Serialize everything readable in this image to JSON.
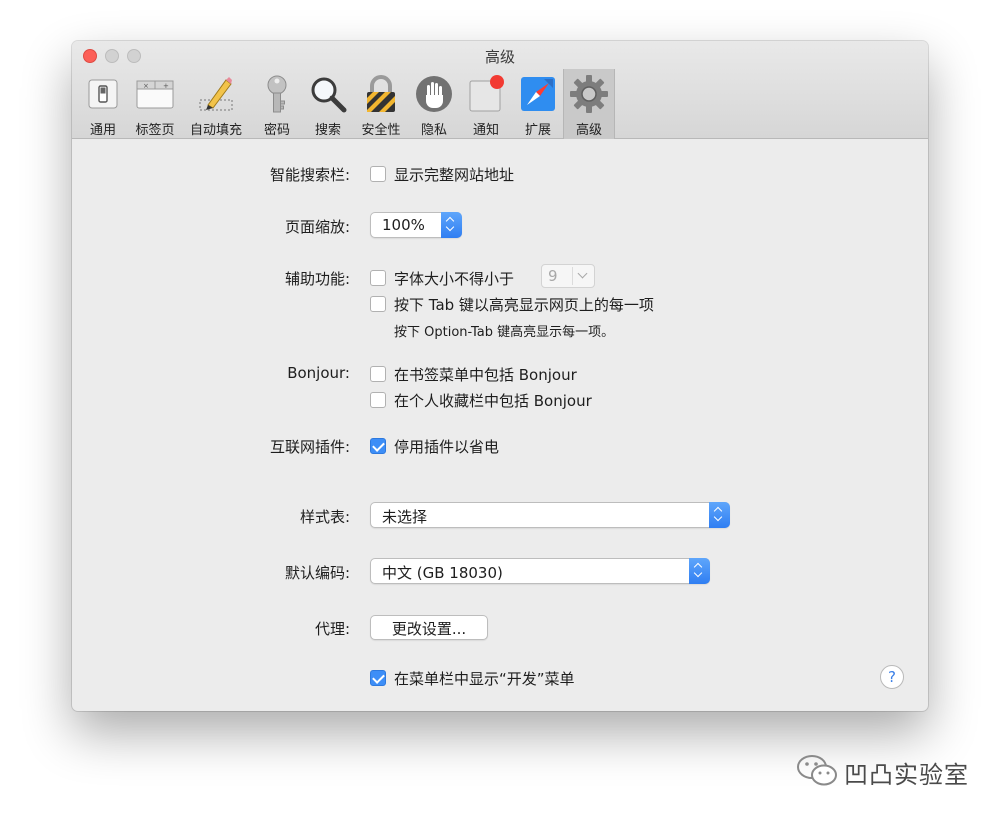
{
  "window": {
    "title": "高级"
  },
  "toolbar": {
    "items": [
      {
        "label": "通用",
        "icon": "general-switch-icon"
      },
      {
        "label": "标签页",
        "icon": "tabs-window-icon"
      },
      {
        "label": "自动填充",
        "icon": "autofill-pencil-icon"
      },
      {
        "label": "密码",
        "icon": "key-icon"
      },
      {
        "label": "搜索",
        "icon": "magnifier-icon"
      },
      {
        "label": "安全性",
        "icon": "padlock-icon"
      },
      {
        "label": "隐私",
        "icon": "hand-stop-icon"
      },
      {
        "label": "通知",
        "icon": "notification-badge-icon"
      },
      {
        "label": "扩展",
        "icon": "compass-icon"
      },
      {
        "label": "高级",
        "icon": "gear-icon",
        "selected": true
      }
    ]
  },
  "settings": {
    "smart_search": {
      "label": "智能搜索栏:",
      "option": "显示完整网站地址",
      "checked": false
    },
    "page_zoom": {
      "label": "页面缩放:",
      "value": "100%"
    },
    "accessibility": {
      "label": "辅助功能:",
      "min_font_option": "字体大小不得小于",
      "min_font_value": "9",
      "min_font_checked": false,
      "tab_option": "按下 Tab 键以高亮显示网页上的每一项",
      "tab_checked": false,
      "tab_hint": "按下 Option-Tab 键高亮显示每一项。"
    },
    "bonjour": {
      "label": "Bonjour:",
      "bookmarks_menu_option": "在书签菜单中包括 Bonjour",
      "bookmarks_menu_checked": false,
      "favorites_bar_option": "在个人收藏栏中包括 Bonjour",
      "favorites_bar_checked": false
    },
    "plugins": {
      "label": "互联网插件:",
      "option": "停用插件以省电",
      "checked": true
    },
    "stylesheet": {
      "label": "样式表:",
      "value": "未选择"
    },
    "encoding": {
      "label": "默认编码:",
      "value": "中文 (GB 18030)"
    },
    "proxies": {
      "label": "代理:",
      "button": "更改设置..."
    },
    "develop_menu": {
      "option": "在菜单栏中显示“开发”菜单",
      "checked": true
    },
    "help": {
      "symbol": "?"
    }
  },
  "watermark": {
    "text": "凹凸实验室"
  },
  "colors": {
    "accent": "#3d8ef7",
    "close": "#fc5f57",
    "window_bg": "#ececec"
  }
}
